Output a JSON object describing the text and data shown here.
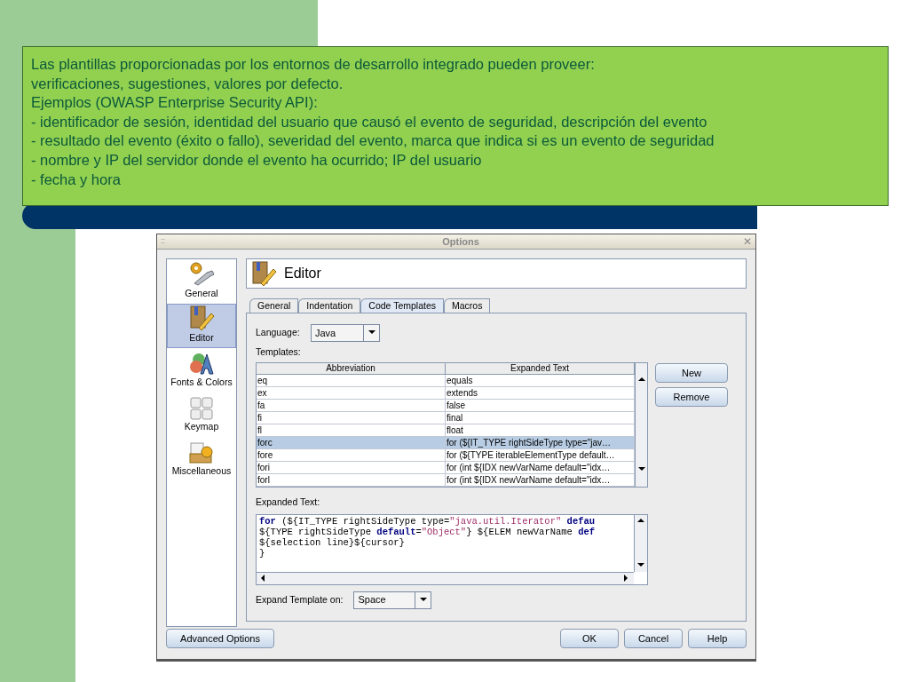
{
  "slide": {
    "lines": [
      "Las plantillas proporcionadas por los entornos de desarrollo integrado pueden proveer:",
      "verificaciones, sugestiones, valores por defecto.",
      "Ejemplos (OWASP Enterprise Security API):",
      "- identificador de sesión,  identidad del usuario que causó el evento de seguridad, descripción del evento",
      "- resultado del evento (éxito o fallo), severidad del evento, marca que indica si es un evento de seguridad",
      "- nombre y IP del servidor donde el evento ha ocurrido; IP del usuario",
      "- fecha y hora"
    ]
  },
  "window": {
    "title": "Options",
    "grip": "::",
    "close": "✕"
  },
  "categories": [
    {
      "label": "General",
      "kind": "gears",
      "selected": false
    },
    {
      "label": "Editor",
      "kind": "editor",
      "selected": true
    },
    {
      "label": "Fonts & Colors",
      "kind": "fonts",
      "selected": false
    },
    {
      "label": "Keymap",
      "kind": "keys",
      "selected": false
    },
    {
      "label": "Miscellaneous",
      "kind": "misc",
      "selected": false
    }
  ],
  "header": {
    "title": "Editor"
  },
  "tabs": [
    {
      "label": "General",
      "selected": false
    },
    {
      "label": "Indentation",
      "selected": false
    },
    {
      "label": "Code Templates",
      "selected": true
    },
    {
      "label": "Macros",
      "selected": false
    }
  ],
  "language": {
    "label": "Language:",
    "value": "Java"
  },
  "templates_label": "Templates:",
  "table": {
    "columns": [
      "Abbreviation",
      "Expanded Text"
    ],
    "rows": [
      {
        "cells": [
          "eq",
          "equals"
        ],
        "selected": false
      },
      {
        "cells": [
          "ex",
          "extends"
        ],
        "selected": false
      },
      {
        "cells": [
          "fa",
          "false"
        ],
        "selected": false
      },
      {
        "cells": [
          "fi",
          "final"
        ],
        "selected": false
      },
      {
        "cells": [
          "fl",
          "float"
        ],
        "selected": false
      },
      {
        "cells": [
          "forc",
          "for (${IT_TYPE rightSideType type=\"jav…"
        ],
        "selected": true
      },
      {
        "cells": [
          "fore",
          "for (${TYPE iterableElementType default…"
        ],
        "selected": false
      },
      {
        "cells": [
          "fori",
          "for (int ${IDX newVarName default=\"idx…"
        ],
        "selected": false
      },
      {
        "cells": [
          "forl",
          "for (int ${IDX newVarName default=\"idx…"
        ],
        "selected": false
      }
    ]
  },
  "side_buttons": [
    "New",
    "Remove"
  ],
  "expanded_label": "Expanded Text:",
  "code": [
    [
      {
        "text": "for",
        "kind": "keyword"
      },
      {
        "text": " (${IT_TYPE rightSideType type=",
        "kind": "plain"
      },
      {
        "text": "\"java.util.Iterator\" ",
        "kind": "string"
      },
      {
        "text": "defau",
        "kind": "keyword"
      }
    ],
    [
      {
        "text": "${TYPE rightSideType ",
        "kind": "plain"
      },
      {
        "text": "default",
        "kind": "keyword"
      },
      {
        "text": "=",
        "kind": "plain"
      },
      {
        "text": "\"Object\"",
        "kind": "string"
      },
      {
        "text": "} ${ELEM newVarName ",
        "kind": "plain"
      },
      {
        "text": "def",
        "kind": "keyword"
      }
    ],
    [
      {
        "text": "${selection line}${cursor}",
        "kind": "plain"
      }
    ],
    [
      {
        "text": "}",
        "kind": "plain"
      }
    ]
  ],
  "expand_on": {
    "label": "Expand Template on:",
    "value": "Space"
  },
  "footer": {
    "left": "Advanced Options",
    "right": [
      "OK",
      "Cancel",
      "Help"
    ]
  }
}
